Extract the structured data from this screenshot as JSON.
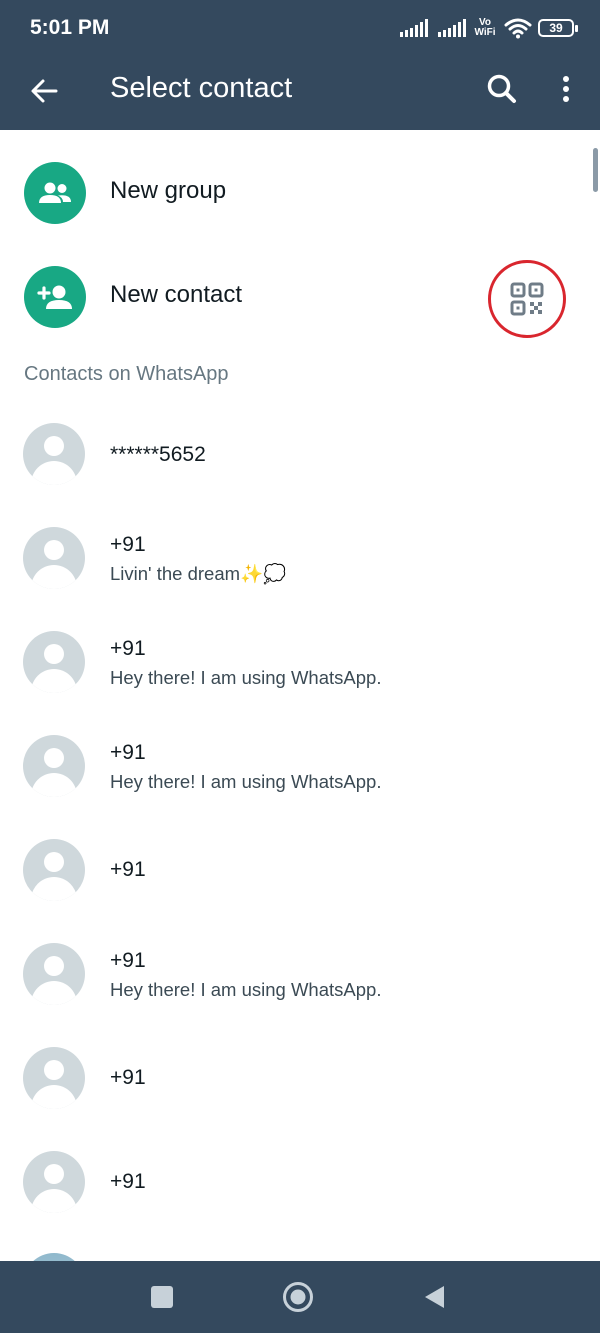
{
  "status_bar": {
    "time": "5:01 PM",
    "vo_label": "Vo",
    "wifi_label": "WiFi",
    "battery": "39"
  },
  "app_bar": {
    "title": "Select contact",
    "icons": [
      "back-arrow-icon",
      "search-icon",
      "more-vert-icon"
    ]
  },
  "actions": [
    {
      "label": "New group",
      "icon": "group-icon"
    },
    {
      "label": "New contact",
      "icon": "person-add-icon",
      "extra_icon": "qr-code-icon"
    }
  ],
  "section": {
    "header": "Contacts on WhatsApp"
  },
  "contacts": [
    {
      "name": "******5652",
      "status": ""
    },
    {
      "name": "+91",
      "status": "Livin' the dream✨💭"
    },
    {
      "name": "+91",
      "status": "Hey there! I am using WhatsApp."
    },
    {
      "name": "+91",
      "status": "Hey there! I am using WhatsApp."
    },
    {
      "name": "+91",
      "status": ""
    },
    {
      "name": "+91",
      "status": "Hey there! I am using WhatsApp."
    },
    {
      "name": "+91",
      "status": ""
    },
    {
      "name": "+91",
      "status": ""
    }
  ],
  "colors": {
    "app_bar": "#34495e",
    "accent_green": "#18a884",
    "highlight_circle": "#d9262e",
    "avatar_bg": "#cfd8dc",
    "section_text": "#667781"
  },
  "nav_bar": {
    "icons": [
      "recents-square-icon",
      "home-circle-icon",
      "back-triangle-icon"
    ]
  }
}
